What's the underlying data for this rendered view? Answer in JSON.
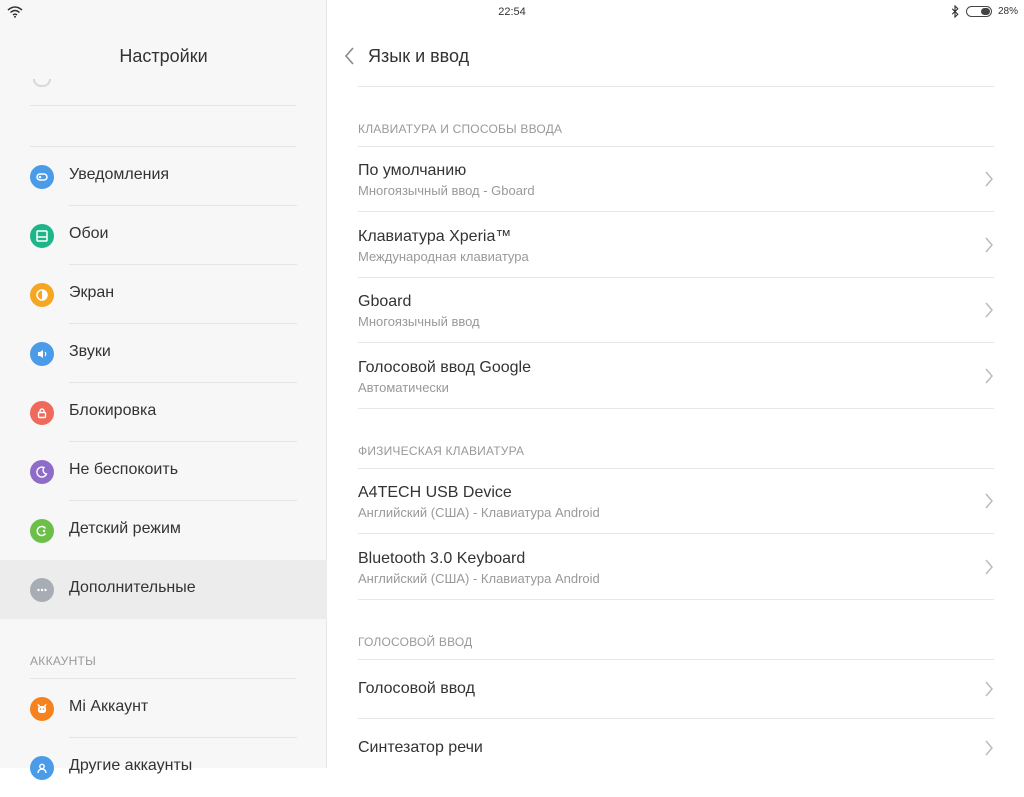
{
  "status": {
    "time": "22:54",
    "battery": "28%",
    "battery_level": 0.28
  },
  "left": {
    "title": "Настройки",
    "items": [
      {
        "label": "Уведомления",
        "icon": "notifications-icon",
        "color": "#4a9be8"
      },
      {
        "label": "Обои",
        "icon": "wallpaper-icon",
        "color": "#1fb58a"
      },
      {
        "label": "Экран",
        "icon": "display-icon",
        "color": "#f5a623"
      },
      {
        "label": "Звуки",
        "icon": "sound-icon",
        "color": "#4a9be8"
      },
      {
        "label": "Блокировка",
        "icon": "lock-icon",
        "color": "#ef6a5a"
      },
      {
        "label": "Не беспокоить",
        "icon": "moon-icon",
        "color": "#8e6cc7"
      },
      {
        "label": "Детский режим",
        "icon": "child-mode-icon",
        "color": "#6cc04a"
      },
      {
        "label": "Дополнительные",
        "icon": "more-icon",
        "color": "#a8adb5",
        "selected": true
      }
    ],
    "accounts_header": "АККАУНТЫ",
    "accounts": [
      {
        "label": "Mi Аккаунт",
        "icon": "mi-account-icon",
        "color": "#f5821f"
      },
      {
        "label": "Другие аккаунты",
        "icon": "user-icon",
        "color": "#4a9be8"
      }
    ]
  },
  "right": {
    "title": "Язык и ввод",
    "sections": [
      {
        "header": "КЛАВИАТУРА И СПОСОБЫ ВВОДА",
        "rows": [
          {
            "title": "По умолчанию",
            "subtitle": "Многоязычный ввод - Gboard"
          },
          {
            "title": "Клавиатура Xperia™",
            "subtitle": "Международная клавиатура"
          },
          {
            "title": "Gboard",
            "subtitle": "Многоязычный ввод"
          },
          {
            "title": "Голосовой ввод Google",
            "subtitle": "Автоматически"
          }
        ]
      },
      {
        "header": "ФИЗИЧЕСКАЯ КЛАВИАТУРА",
        "rows": [
          {
            "title": "A4TECH USB Device",
            "subtitle": "Английский (США) - Клавиатура Android"
          },
          {
            "title": "Bluetooth 3.0 Keyboard",
            "subtitle": "Английский (США) - Клавиатура Android"
          }
        ]
      },
      {
        "header": "ГОЛОСОВОЙ ВВОД",
        "rows": [
          {
            "title": "Голосовой ввод"
          },
          {
            "title": "Синтезатор речи"
          }
        ]
      }
    ]
  }
}
